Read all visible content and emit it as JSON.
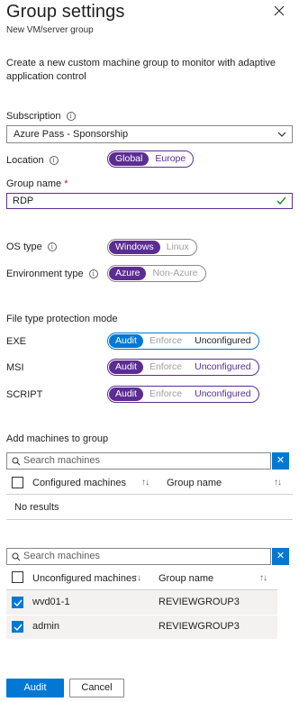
{
  "header": {
    "title": "Group settings",
    "subtitle": "New VM/server group"
  },
  "description": "Create a new custom machine group to monitor with adaptive application control",
  "subscription": {
    "label": "Subscription",
    "value": "Azure Pass - Sponsorship"
  },
  "location": {
    "label": "Location",
    "options": [
      "Global",
      "Europe"
    ],
    "selected": "Global"
  },
  "group_name": {
    "label": "Group name",
    "required_mark": "*",
    "value": "RDP"
  },
  "os_type": {
    "label": "OS type",
    "options": [
      "Windows",
      "Linux"
    ],
    "selected": "Windows"
  },
  "environment_type": {
    "label": "Environment type",
    "options": [
      "Azure",
      "Non-Azure"
    ],
    "selected": "Azure"
  },
  "file_protection": {
    "title": "File type protection mode",
    "modes": [
      "Audit",
      "Enforce",
      "Unconfigured"
    ],
    "rows": [
      {
        "label": "EXE",
        "selected": "Audit"
      },
      {
        "label": "MSI",
        "selected": "Audit"
      },
      {
        "label": "SCRIPT",
        "selected": "Audit"
      }
    ]
  },
  "add_machines": {
    "title": "Add machines to group",
    "configured": {
      "search_placeholder": "Search machines",
      "col_machines": "Configured machines",
      "col_group": "Group name",
      "sort_glyph": "↑↓",
      "empty": "No results"
    },
    "unconfigured": {
      "search_placeholder": "Search machines",
      "col_machines": "Unconfigured machines",
      "col_group": "Group name",
      "sort_glyph": "↑↓",
      "rows": [
        {
          "name": "wvd01-1",
          "group": "REVIEWGROUP3",
          "checked": true
        },
        {
          "name": "admin",
          "group": "REVIEWGROUP3",
          "checked": true
        }
      ]
    }
  },
  "footer": {
    "primary": "Audit",
    "secondary": "Cancel"
  },
  "colors": {
    "accent_purple": "#5c2d91",
    "accent_blue": "#0078d4",
    "valid_green": "#107c10"
  }
}
